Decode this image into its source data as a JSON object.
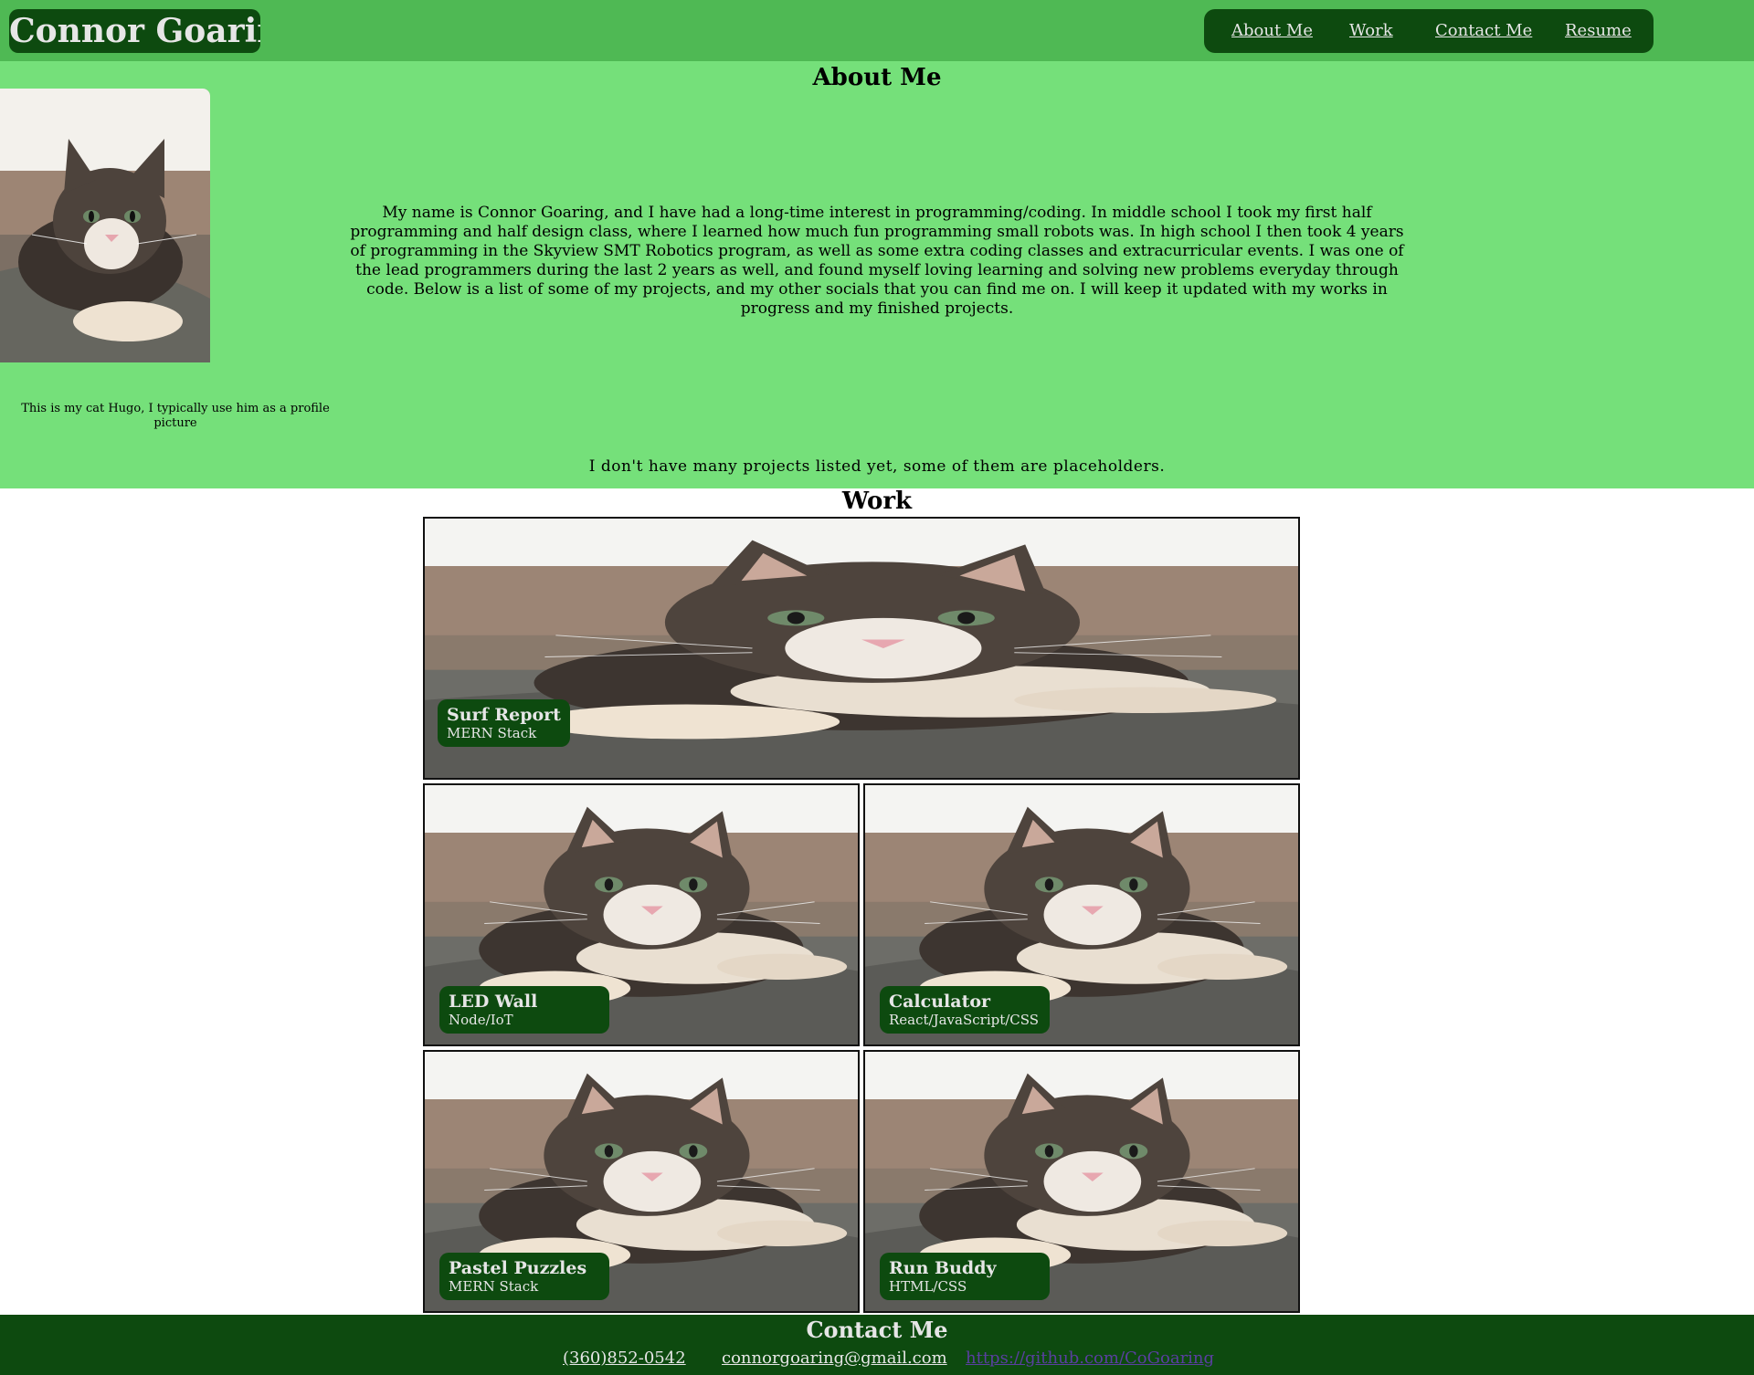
{
  "header": {
    "brand": "Connor Goaring",
    "nav": [
      "About Me",
      "Work",
      "Contact Me",
      "Resume"
    ]
  },
  "about": {
    "title": "About Me",
    "bio": "My name is Connor Goaring, and I have had a long-time interest in programming/coding. In middle school I took my first half programming and half design class, where I learned how much fun programming small robots was. In high school I then took 4 years of programming in the Skyview SMT Robotics program, as well as some extra coding classes and extracurricular events. I was one of the lead programmers during the last 2 years as well, and found myself loving learning and solving new problems everyday through code. Below is a list of some of my projects, and my other socials that you can find me on. I will keep it updated with my works in progress and my finished projects.",
    "caption": "This is my cat Hugo, I typically use him as a profile picture",
    "note": "I don't have many projects listed yet, some of them are placeholders."
  },
  "work": {
    "title": "Work",
    "projects": [
      {
        "name": "Surf Report",
        "tech": "MERN Stack"
      },
      {
        "name": "LED Wall",
        "tech": "Node/IoT"
      },
      {
        "name": "Calculator",
        "tech": "React/JavaScript/CSS"
      },
      {
        "name": "Pastel Puzzles",
        "tech": "MERN Stack"
      },
      {
        "name": "Run Buddy",
        "tech": "HTML/CSS"
      }
    ]
  },
  "contact": {
    "title": "Contact Me",
    "phone": "(360)852-0542",
    "email": "connorgoaring@gmail.com",
    "github": "https://github.com/CoGoaring"
  },
  "colors": {
    "header_bg": "#4fb954",
    "dark_green": "#0d4a0f",
    "about_bg": "#75e07a"
  }
}
